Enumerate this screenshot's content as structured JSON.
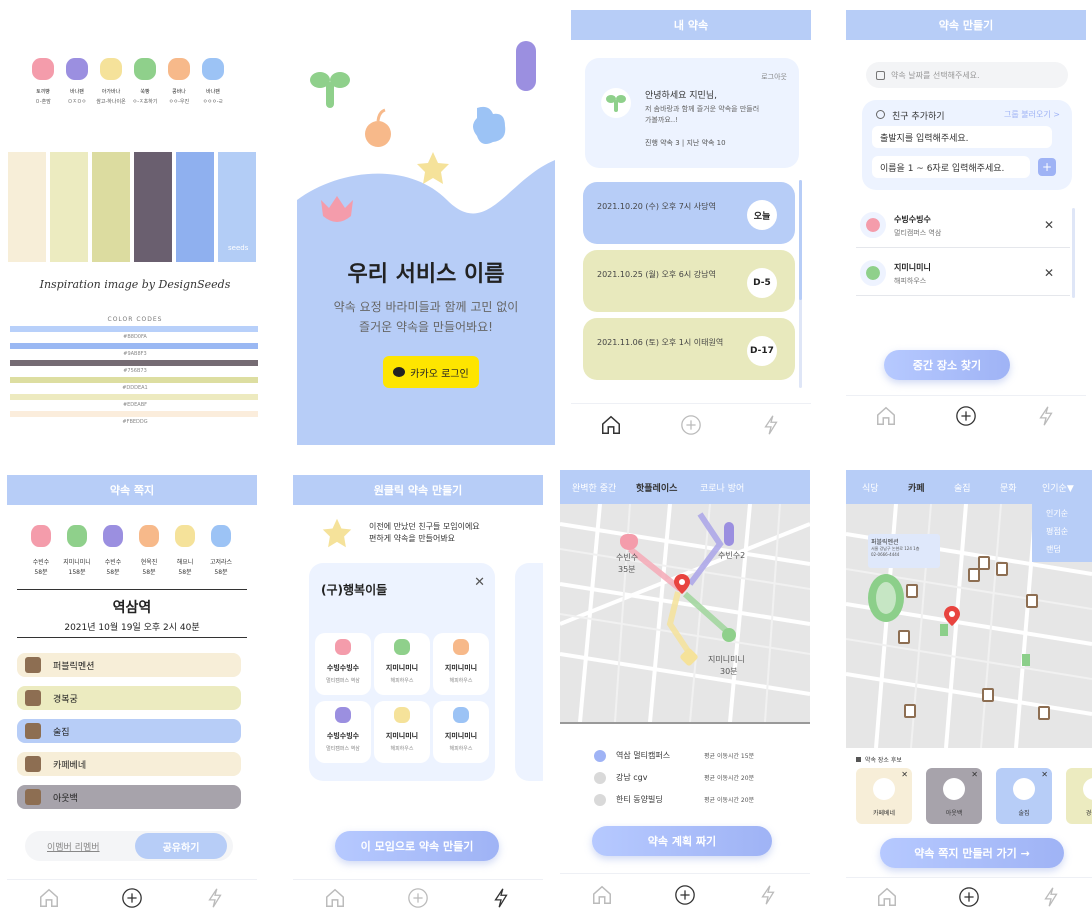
{
  "style_guide": {
    "characters": [
      {
        "name": "토끼빵",
        "sub": "ㅁ-혼맘",
        "color": "#f49cab"
      },
      {
        "name": "바나팬",
        "sub": "ㅁㅈㅁㅇ",
        "color": "#9b8fe0"
      },
      {
        "name": "아가바나",
        "sub": "쌈고-하나이온",
        "color": "#f5e29a"
      },
      {
        "name": "쑥빵",
        "sub": "ㅇ-ㅈ초하기",
        "color": "#8fd08b"
      },
      {
        "name": "콩바나",
        "sub": "ㅇㅇ-우진",
        "color": "#f7b98a"
      },
      {
        "name": "바나팬",
        "sub": "ㅇㅇㅇ-ㄹ",
        "color": "#9cc3f5"
      }
    ],
    "palette": [
      "#f7eed8",
      "#ecebc0",
      "#dcdca0",
      "#6a5f6f",
      "#8fb0ef",
      "#b3cdf6"
    ],
    "watermark": "seeds",
    "inspiration": "Inspiration image by DesignSeeds",
    "color_codes_title": "COLOR CODES",
    "codes": [
      "#B8D0FA",
      "#9AB8F3",
      "#756B73",
      "#DDDEA1",
      "#EDEABF",
      "#FBEDDG"
    ],
    "code_colors": [
      "#b8d0fa",
      "#9ab8f3",
      "#756b73",
      "#dddea1",
      "#edeabf",
      "#fbeddc"
    ]
  },
  "login": {
    "title": "우리 서비스 이름",
    "subtitle1": "약속 요정 바라미들과 함께 고민 없이",
    "subtitle2": "즐거운 약속을 만들어봐요!",
    "kakao_button": "카카오 로그인"
  },
  "my_promise": {
    "header": "내 약속",
    "logout": "로그아웃",
    "greeting": "안녕하세요 지민님,",
    "desc1": "저 솜바랑과 함께 즐거운 약속을 만들러",
    "desc2": "가볼까요..!",
    "stats": "진행 약속 3 | 지난 약속 10",
    "items": [
      {
        "text": "2021.10.20 (수) 오후 7시 사당역",
        "badge": "오늘",
        "color": "#b7cdf7"
      },
      {
        "text": "2021.10.25 (월) 오후 6시 강남역",
        "badge": "D-5",
        "color": "#e8e9bd"
      },
      {
        "text": "2021.11.06 (토) 오후 1시 이태원역",
        "badge": "D-17",
        "color": "#e8e9bd"
      }
    ]
  },
  "make_promise": {
    "header": "약속 만들기",
    "date_placeholder": "약속 날짜를 선택해주세요.",
    "add_friend": "친구 추가하기",
    "load_group": "그룹 불러오기 >",
    "origin_placeholder": "출발지를 입력해주세요.",
    "name_placeholder": "이름을 1 ~ 6자로 입력해주세요.",
    "friends": [
      {
        "name": "수빙수빙수",
        "place": "멀티캠퍼스 역삼",
        "color": "#f49cab"
      },
      {
        "name": "지미니미니",
        "place": "해피하우스",
        "color": "#8fd08b"
      }
    ],
    "find_button": "중간 장소 찾기"
  },
  "promise_detail": {
    "header": "약속 쪽지",
    "members": [
      {
        "name": "수빈수",
        "time": "58분",
        "color": "#f49cab"
      },
      {
        "name": "지미니미니",
        "time": "158분",
        "color": "#8fd08b"
      },
      {
        "name": "수빈수",
        "time": "58분",
        "color": "#9b8fe0"
      },
      {
        "name": "현옥진",
        "time": "58분",
        "color": "#f7b98a"
      },
      {
        "name": "해요니",
        "time": "58분",
        "color": "#f5e29a"
      },
      {
        "name": "고저라스",
        "time": "58분",
        "color": "#9cc3f5"
      }
    ],
    "station": "역삼역",
    "datetime": "2021년 10월 19일 오후 2시 40분",
    "places": [
      {
        "name": "퍼블릭멘션",
        "color": "#f7eed8"
      },
      {
        "name": "경복궁",
        "color": "#ecebc0"
      },
      {
        "name": "술집",
        "color": "#b7cdf7"
      },
      {
        "name": "카페베네",
        "color": "#f7eed8"
      },
      {
        "name": "아웃백",
        "color": "#a7a3ab"
      }
    ],
    "member_link": "이멤버 리멤버",
    "share": "공유하기"
  },
  "one_click": {
    "header": "원클릭 약속 만들기",
    "tip1": "이전에 만났던 친구들 모임이에요",
    "tip2": "편하게 약속을 만들어봐요",
    "group_name": "(구)행복이들",
    "members": [
      {
        "name": "수빙수빙수",
        "place": "멀티캠퍼스 역삼",
        "color": "#f49cab"
      },
      {
        "name": "지미니미니",
        "place": "해피하우스",
        "color": "#8fd08b"
      },
      {
        "name": "지미니미니",
        "place": "해피하우스",
        "color": "#f7b98a"
      },
      {
        "name": "수빙수빙수",
        "place": "멀티캠퍼스 역삼",
        "color": "#9b8fe0"
      },
      {
        "name": "지미니미니",
        "place": "해피하우스",
        "color": "#f5e29a"
      },
      {
        "name": "지미니미니",
        "place": "해피하우스",
        "color": "#9cc3f5"
      }
    ],
    "create_button": "이 모임으로 약속 만들기"
  },
  "midpoint": {
    "tabs": [
      "완벽한 중간",
      "핫플레이스",
      "코로나 방어"
    ],
    "map_labels": [
      "수빈수",
      "35분",
      "수빈수2",
      "지미니미니",
      "30분"
    ],
    "results": [
      {
        "name": "역삼 멀티캠퍼스",
        "time": "평균 이동시간 15분",
        "color": "#9fb3f5"
      },
      {
        "name": "강남 cgv",
        "time": "평균 이동시간 20분",
        "color": "#d9d9d9"
      },
      {
        "name": "한티 동양빌딩",
        "time": "평균 이동시간 20분",
        "color": "#d9d9d9"
      }
    ],
    "plan_button": "약속 계획 짜기"
  },
  "places": {
    "tabs": [
      "식당",
      "카페",
      "술집",
      "문화",
      "인기순▼"
    ],
    "sort_options": [
      "인기순",
      "평점순",
      "랜덤"
    ],
    "popup": {
      "title": "퍼블릭멘션",
      "line1": "서울 강남구 논현로 124 1층",
      "line2": "02-0666-4444"
    },
    "candidate_label": "약속 장소 후보",
    "candidates": [
      {
        "name": "카페베네",
        "color": "#f7eed8"
      },
      {
        "name": "아웃백",
        "color": "#a7a3ab"
      },
      {
        "name": "술집",
        "color": "#b7cdf7"
      },
      {
        "name": "경복궁",
        "color": "#ecebc0"
      }
    ],
    "go_button": "약속 쪽지 만들러 가기 →"
  }
}
